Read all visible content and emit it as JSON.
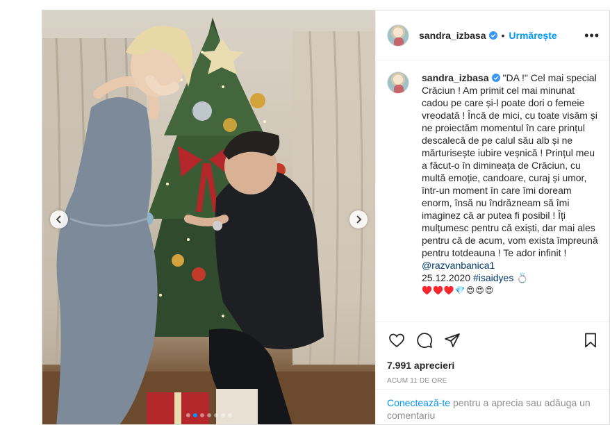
{
  "post": {
    "username": "sandra_izbasa",
    "follow_label": "Urmărește",
    "more_icon": "more-options-icon",
    "separator": "•"
  },
  "photo": {
    "alt": "",
    "carousel_total": 7,
    "carousel_active": 1
  },
  "caption": {
    "username": "sandra_izbasa",
    "text": "\"DA !\" Cel mai special Crăciun ! Am primit cel mai minunat cadou pe care și-l poate dori o femeie vreodată ! Încă de mici, cu toate visăm și ne proiectăm momentul în care prințul descalecă de pe calul său alb și ne mărturisește iubire veșnică ! Prințul meu a făcut-o în dimineața de Crăciun, cu multă emoție, candoare, curaj și umor, într-un moment în care îmi doream enorm, însă nu îndrăzneam să îmi imaginez că ar putea fi posibil ! Îți mulțumesc pentru că exiști, dar mai ales pentru că de acum, vom exista împreună pentru totdeauna ! Te ador infinit !",
    "mention": "@razvanbanica1",
    "date": "25.12.2020",
    "hashtag": "#isaidyes",
    "ring_emoji": "💍",
    "emoji_line": "♥️♥️♥️💎😍😍😍"
  },
  "actions": {
    "like_icon": "heart-icon",
    "comment_icon": "comment-icon",
    "share_icon": "share-icon",
    "save_icon": "bookmark-icon",
    "likes": "7.991 aprecieri",
    "time": "ACUM 11 DE ORE"
  },
  "login": {
    "connect": "Conectează-te",
    "rest": " pentru a aprecia sau adăuga un comentariu"
  },
  "colors": {
    "accent": "#0095f6",
    "link": "#00376b",
    "text": "#262626",
    "muted": "#8e8e8e",
    "border": "#dbdbdb"
  }
}
